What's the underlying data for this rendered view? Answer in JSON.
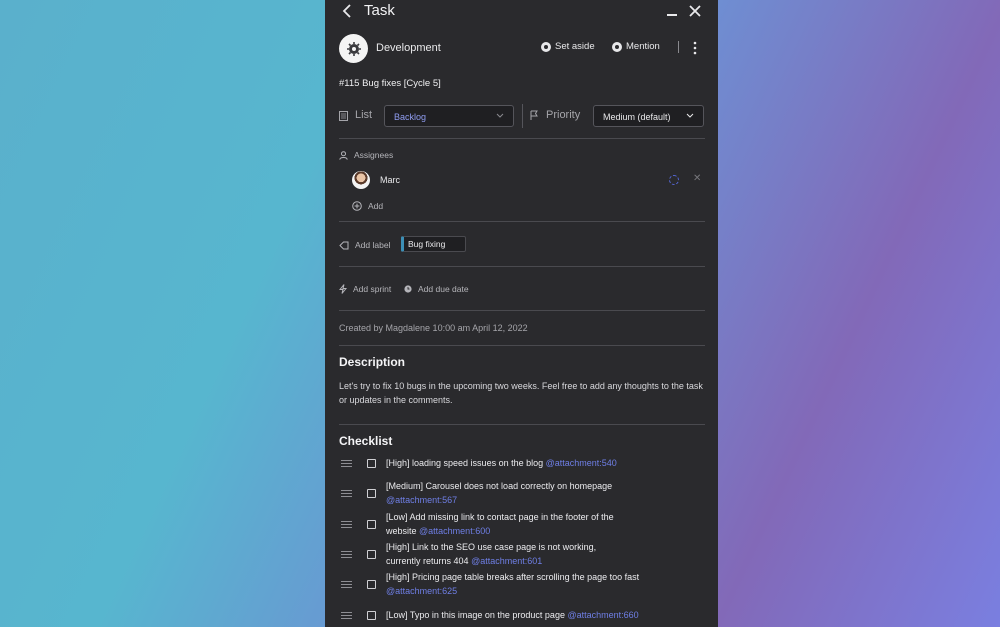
{
  "header": {
    "title": "Task"
  },
  "project": {
    "name": "Development",
    "set_aside": "Set aside",
    "mention": "Mention"
  },
  "task_id": "#115 Bug fixes [Cycle 5]",
  "fields": {
    "list_label": "List",
    "list_value": "Backlog",
    "priority_label": "Priority",
    "priority_value": "Medium (default)"
  },
  "assignees": {
    "label": "Assignees",
    "people": [
      {
        "name": "Marc"
      }
    ],
    "add_label": "Add"
  },
  "labels": {
    "add_label": "Add label",
    "tags": [
      {
        "text": "Bug fixing",
        "color": "#3c8fb6"
      }
    ]
  },
  "sprint": {
    "add_sprint": "Add sprint",
    "add_due_date": "Add due date"
  },
  "created": "Created by Magdalene 10:00 am April 12, 2022",
  "description": {
    "heading": "Description",
    "body": "Let's try to fix 10 bugs in the upcoming two weeks. Feel free to add any thoughts to the task or updates in the comments."
  },
  "checklist": {
    "heading": "Checklist",
    "items": [
      {
        "text": "[High] loading speed issues on the blog",
        "attachment": "@attachment:540"
      },
      {
        "text": "[Medium] Carousel does not load correctly on homepage",
        "attachment": "@attachment:567"
      },
      {
        "text": "[Low] Add missing link to contact page in the footer of the website",
        "attachment": "@attachment:600"
      },
      {
        "text": "[High] Link to the SEO use case page is not working, currently returns 404",
        "attachment": "@attachment:601"
      },
      {
        "text": "[High] Pricing page table breaks after scrolling the page too fast",
        "attachment": "@attachment:625"
      },
      {
        "text": "[Low] Typo in this image on the product page",
        "attachment": "@attachment:660"
      }
    ]
  },
  "colors": {
    "panel": "#2a2a2d",
    "accent_link": "#6f7fe6",
    "tag_accent": "#3c8fb6"
  }
}
